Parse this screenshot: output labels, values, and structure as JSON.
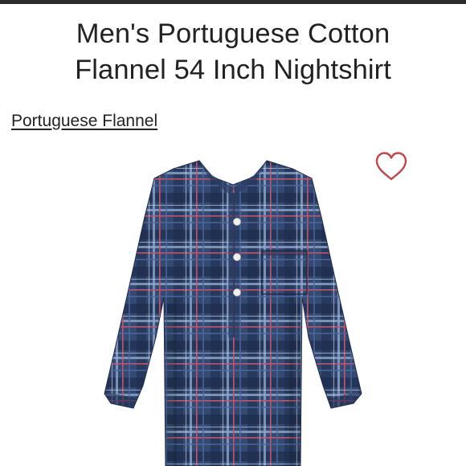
{
  "listing": {
    "title_line1": "Men's Portuguese Cotton",
    "title_line2": "Flannel 54 Inch Nightshirt",
    "brand": "Portuguese Flannel"
  },
  "icons": {
    "favorite": "heart-outline-icon"
  },
  "colors": {
    "heart": "#c0464f",
    "plaid_base": "#344a73",
    "plaid_dark": "#1e2d4f",
    "plaid_pink": "#c0556e",
    "plaid_light": "#8fa6cc",
    "button": "#f3f0ea"
  }
}
